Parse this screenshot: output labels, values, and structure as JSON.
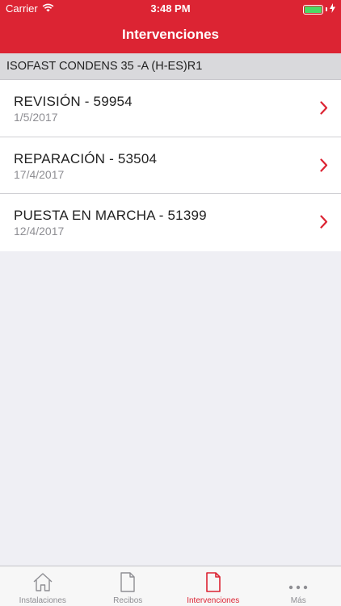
{
  "status_bar": {
    "carrier": "Carrier",
    "time": "3:48 PM"
  },
  "nav": {
    "title": "Intervenciones"
  },
  "section": {
    "title": "ISOFAST CONDENS 35 -A (H-ES)R1"
  },
  "interventions": [
    {
      "title": "REVISIÓN - 59954",
      "date": "1/5/2017"
    },
    {
      "title": "REPARACIÓN - 53504",
      "date": "17/4/2017"
    },
    {
      "title": "PUESTA EN MARCHA - 51399",
      "date": "12/4/2017"
    }
  ],
  "tabs": [
    {
      "label": "Instalaciones",
      "icon": "home-icon",
      "active": false
    },
    {
      "label": "Recibos",
      "icon": "document-icon",
      "active": false
    },
    {
      "label": "Intervenciones",
      "icon": "document-icon",
      "active": true
    },
    {
      "label": "Más",
      "icon": "more-dots-icon",
      "active": false
    }
  ],
  "colors": {
    "brand_red": "#dc2433",
    "battery_green": "#4cd964",
    "inactive_gray": "#8e8e93"
  }
}
